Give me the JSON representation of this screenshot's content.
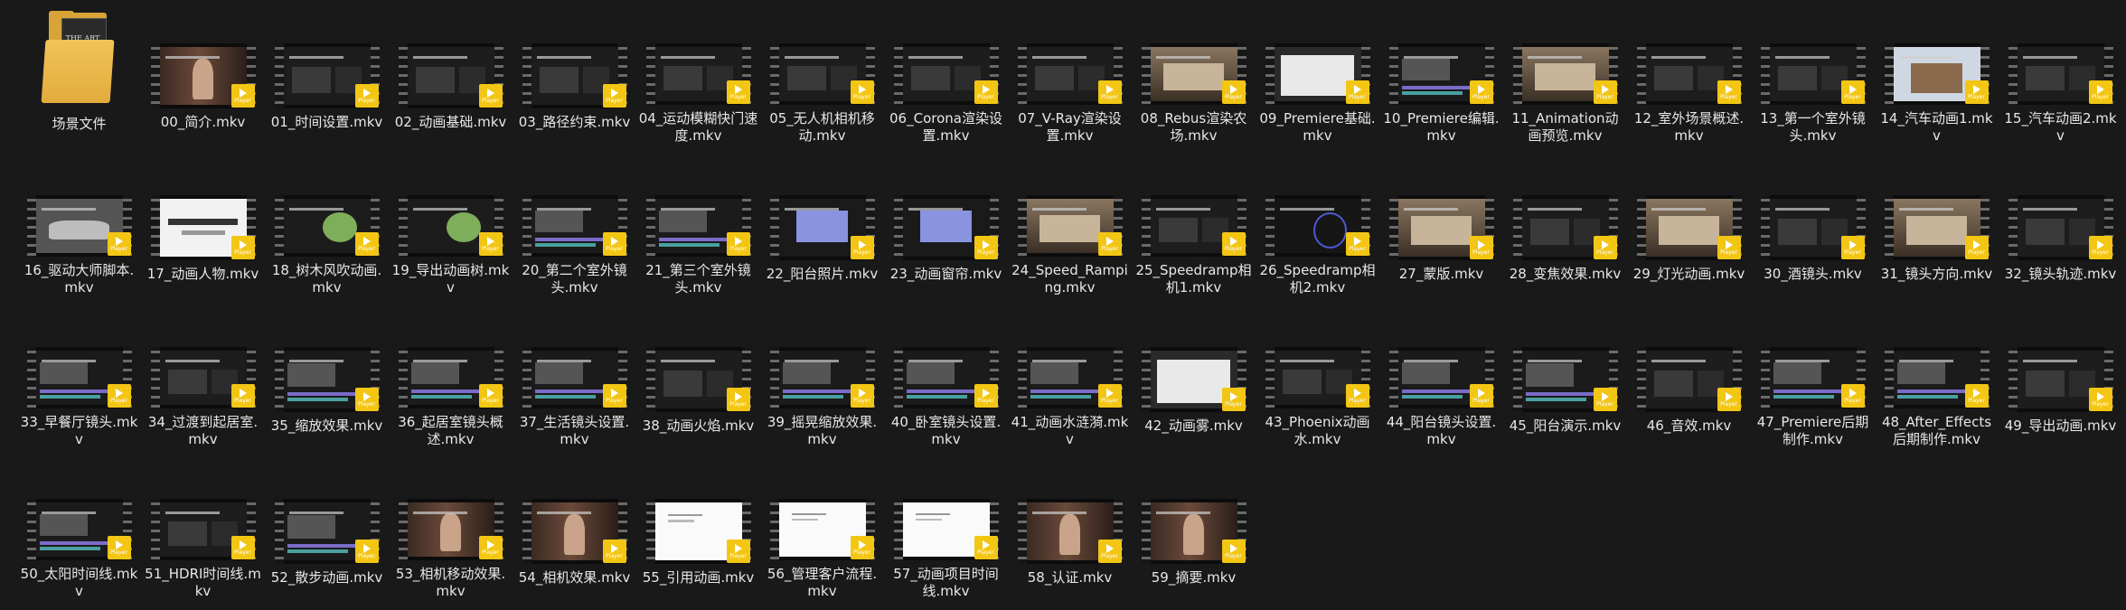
{
  "folder": {
    "name": "场景文件",
    "cover_text": "THE ART OF ARCH VIZ"
  },
  "badge_text": "Player",
  "colors": {
    "background": "#191919",
    "badge": "#f3c614",
    "folder": "#e2ab3c"
  },
  "items": [
    {
      "name": "00_简介.mkv",
      "kind": "person"
    },
    {
      "name": "01_时间设置.mkv",
      "kind": "ui"
    },
    {
      "name": "02_动画基础.mkv",
      "kind": "ui"
    },
    {
      "name": "03_路径约束.mkv",
      "kind": "ui"
    },
    {
      "name": "04_运动模糊快门速度.mkv",
      "kind": "ui"
    },
    {
      "name": "05_无人机相机移动.mkv",
      "kind": "ui"
    },
    {
      "name": "06_Corona渲染设置.mkv",
      "kind": "ui"
    },
    {
      "name": "07_V-Ray渲染设置.mkv",
      "kind": "ui"
    },
    {
      "name": "08_Rebus渲染农场.mkv",
      "kind": "room"
    },
    {
      "name": "09_Premiere基础.mkv",
      "kind": "light"
    },
    {
      "name": "10_Premiere编辑.mkv",
      "kind": "timeline"
    },
    {
      "name": "11_Animation动画预览.mkv",
      "kind": "room"
    },
    {
      "name": "12_室外场景概述.mkv",
      "kind": "ui"
    },
    {
      "name": "13_第一个室外镜头.mkv",
      "kind": "ui"
    },
    {
      "name": "14_汽车动画1.mkv",
      "kind": "building"
    },
    {
      "name": "15_汽车动画2.mkv",
      "kind": "ui"
    },
    {
      "name": "16_驱动大师脚本.mkv",
      "kind": "car"
    },
    {
      "name": "17_动画人物.mkv",
      "kind": "web"
    },
    {
      "name": "18_树木风吹动画.mkv",
      "kind": "tree"
    },
    {
      "name": "19_导出动画树.mkv",
      "kind": "tree"
    },
    {
      "name": "20_第二个室外镜头.mkv",
      "kind": "timeline"
    },
    {
      "name": "21_第三个室外镜头.mkv",
      "kind": "timeline"
    },
    {
      "name": "22_阳台照片.mkv",
      "kind": "blue"
    },
    {
      "name": "23_动画窗帘.mkv",
      "kind": "blue"
    },
    {
      "name": "24_Speed_Ramping.mkv",
      "kind": "room"
    },
    {
      "name": "25_Speedramp相机1.mkv",
      "kind": "ui"
    },
    {
      "name": "26_Speedramp相机2.mkv",
      "kind": "circle"
    },
    {
      "name": "27_蒙版.mkv",
      "kind": "room"
    },
    {
      "name": "28_变焦效果.mkv",
      "kind": "ui"
    },
    {
      "name": "29_灯光动画.mkv",
      "kind": "room"
    },
    {
      "name": "30_酒镜头.mkv",
      "kind": "ui"
    },
    {
      "name": "31_镜头方向.mkv",
      "kind": "room"
    },
    {
      "name": "32_镜头轨迹.mkv",
      "kind": "ui"
    },
    {
      "name": "33_早餐厅镜头.mkv",
      "kind": "timeline"
    },
    {
      "name": "34_过渡到起居室.mkv",
      "kind": "ui"
    },
    {
      "name": "35_缩放效果.mkv",
      "kind": "timeline"
    },
    {
      "name": "36_起居室镜头概述.mkv",
      "kind": "timeline"
    },
    {
      "name": "37_生活镜头设置.mkv",
      "kind": "timeline"
    },
    {
      "name": "38_动画火焰.mkv",
      "kind": "ui"
    },
    {
      "name": "39_摇晃缩放效果.mkv",
      "kind": "timeline"
    },
    {
      "name": "40_卧室镜头设置.mkv",
      "kind": "timeline"
    },
    {
      "name": "41_动画水涟漪.mkv",
      "kind": "timeline"
    },
    {
      "name": "42_动画雾.mkv",
      "kind": "light"
    },
    {
      "name": "43_Phoenix动画水.mkv",
      "kind": "ui"
    },
    {
      "name": "44_阳台镜头设置.mkv",
      "kind": "timeline"
    },
    {
      "name": "45_阳台演示.mkv",
      "kind": "timeline"
    },
    {
      "name": "46_音效.mkv",
      "kind": "ui"
    },
    {
      "name": "47_Premiere后期制作.mkv",
      "kind": "timeline"
    },
    {
      "name": "48_After_Effects后期制作.mkv",
      "kind": "timeline"
    },
    {
      "name": "49_导出动画.mkv",
      "kind": "ui"
    },
    {
      "name": "50_太阳时间线.mkv",
      "kind": "timeline"
    },
    {
      "name": "51_HDRI时间线.mkv",
      "kind": "ui"
    },
    {
      "name": "52_散步动画.mkv",
      "kind": "timeline"
    },
    {
      "name": "53_相机移动效果.mkv",
      "kind": "person"
    },
    {
      "name": "54_相机效果.mkv",
      "kind": "person"
    },
    {
      "name": "55_引用动画.mkv",
      "kind": "white"
    },
    {
      "name": "56_管理客户流程.mkv",
      "kind": "white"
    },
    {
      "name": "57_动画项目时间线.mkv",
      "kind": "white"
    },
    {
      "name": "58_认证.mkv",
      "kind": "person"
    },
    {
      "name": "59_摘要.mkv",
      "kind": "person"
    }
  ]
}
